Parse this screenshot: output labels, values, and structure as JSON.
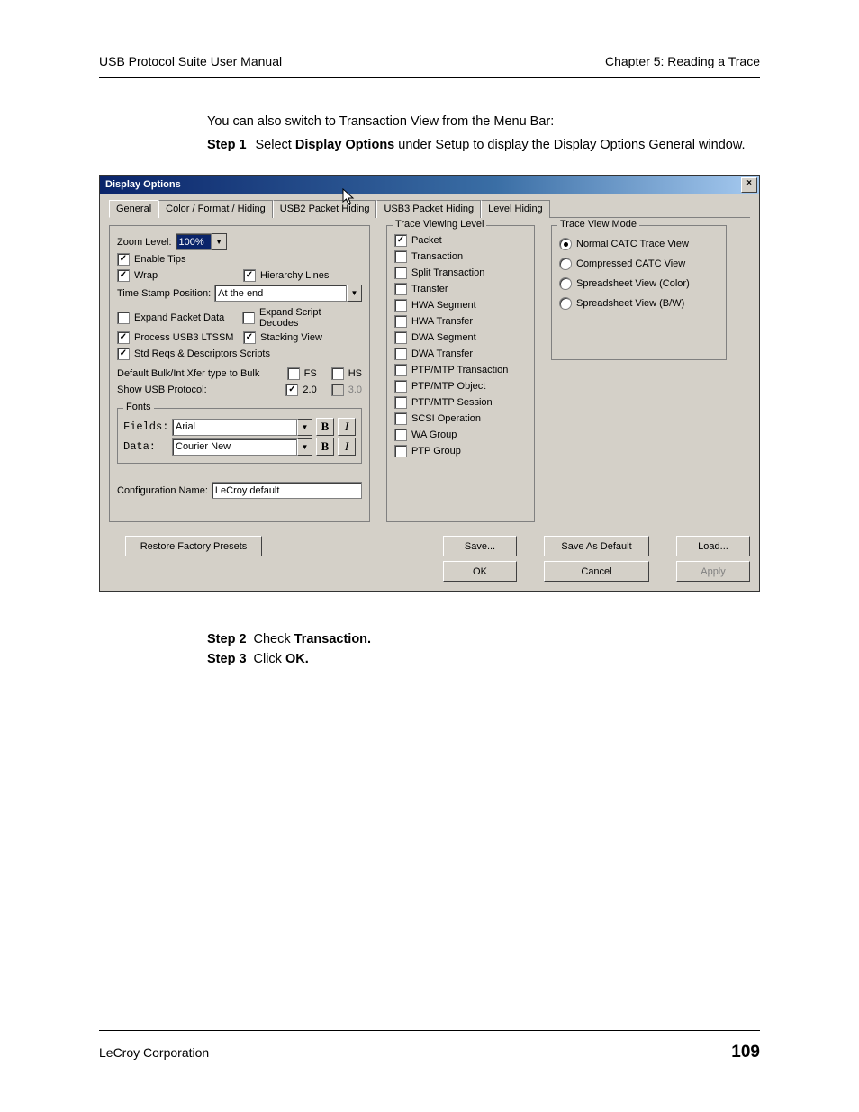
{
  "header": {
    "left": "USB Protocol Suite User Manual",
    "right": "Chapter 5: Reading a Trace"
  },
  "intro": {
    "lead": "You can also switch to Transaction View from the Menu Bar:",
    "step1_label": "Step 1",
    "step1_a": "Select ",
    "step1_bold": "Display Options",
    "step1_b": " under Setup to display the Display Options General window."
  },
  "dialog": {
    "title": "Display Options",
    "close": "×",
    "tabs": [
      "General",
      "Color / Format / Hiding",
      "USB2 Packet Hiding",
      "USB3 Packet Hiding",
      "Level Hiding"
    ],
    "general": {
      "zoom_label": "Zoom Level:",
      "zoom_value": "100%",
      "enable_tips": "Enable Tips",
      "wrap": "Wrap",
      "hierarchy_lines": "Hierarchy Lines",
      "tsp_label": "Time Stamp Position:",
      "tsp_value": "At the end",
      "expand_packet": "Expand Packet Data",
      "expand_script": "Expand Script Decodes",
      "process_ltssm": "Process USB3 LTSSM",
      "stacking_view": "Stacking View",
      "std_reqs": "Std Reqs & Descriptors Scripts",
      "default_bulk": "Default Bulk/Int Xfer type to Bulk",
      "fs": "FS",
      "hs": "HS",
      "show_usb": "Show USB Protocol:",
      "p20": "2.0",
      "p30": "3.0",
      "fonts_legend": "Fonts",
      "fields_label": "Fields:",
      "fields_font": "Arial",
      "data_label": "Data:",
      "data_font": "Courier New",
      "B": "B",
      "I": "I",
      "cfg_label": "Configuration Name:",
      "cfg_value": "LeCroy default"
    },
    "trace_level": {
      "legend": "Trace Viewing Level",
      "items": [
        {
          "label": "Packet",
          "checked": true
        },
        {
          "label": "Transaction",
          "checked": false
        },
        {
          "label": "Split Transaction",
          "checked": false
        },
        {
          "label": "Transfer",
          "checked": false
        },
        {
          "label": "HWA Segment",
          "checked": false
        },
        {
          "label": "HWA Transfer",
          "checked": false
        },
        {
          "label": "DWA Segment",
          "checked": false
        },
        {
          "label": "DWA Transfer",
          "checked": false
        },
        {
          "label": "PTP/MTP Transaction",
          "checked": false
        },
        {
          "label": "PTP/MTP Object",
          "checked": false
        },
        {
          "label": "PTP/MTP Session",
          "checked": false
        },
        {
          "label": "SCSI Operation",
          "checked": false
        },
        {
          "label": "WA Group",
          "checked": false
        },
        {
          "label": "PTP Group",
          "checked": false
        }
      ]
    },
    "trace_mode": {
      "legend": "Trace View Mode",
      "items": [
        {
          "label": "Normal CATC Trace View",
          "checked": true
        },
        {
          "label": "Compressed CATC View",
          "checked": false
        },
        {
          "label": "Spreadsheet View (Color)",
          "checked": false
        },
        {
          "label": "Spreadsheet View (B/W)",
          "checked": false
        }
      ]
    },
    "buttons": {
      "restore": "Restore Factory Presets",
      "save": "Save...",
      "save_default": "Save As Default",
      "load": "Load...",
      "ok": "OK",
      "cancel": "Cancel",
      "apply": "Apply"
    }
  },
  "after": {
    "step2_label": "Step 2",
    "step2_a": "Check ",
    "step2_bold": "Transaction.",
    "step3_label": "Step 3",
    "step3_a": "Click ",
    "step3_bold": "OK."
  },
  "footer": {
    "corp": "LeCroy Corporation",
    "page": "109"
  }
}
